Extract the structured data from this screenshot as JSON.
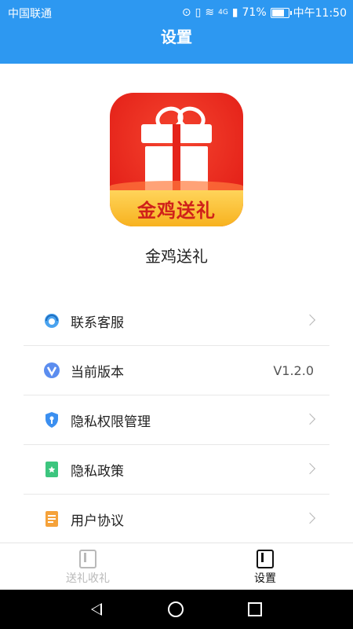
{
  "status_bar": {
    "carrier": "中国联通",
    "network": "4G",
    "battery": "71%",
    "battery_level": 0.71,
    "time": "中午11:50"
  },
  "header": {
    "title": "设置"
  },
  "app": {
    "logo_text": "金鸡送礼",
    "name": "金鸡送礼"
  },
  "menu": {
    "items": [
      {
        "label": "联系客服",
        "icon": "customer-service-icon"
      },
      {
        "label": "当前版本",
        "icon": "version-icon",
        "value": "V1.2.0"
      },
      {
        "label": "隐私权限管理",
        "icon": "privacy-permission-icon"
      },
      {
        "label": "隐私政策",
        "icon": "privacy-policy-icon"
      },
      {
        "label": "用户协议",
        "icon": "user-agreement-icon"
      }
    ]
  },
  "bottom_nav": {
    "tabs": [
      {
        "label": "送礼收礼",
        "active": false
      },
      {
        "label": "设置",
        "active": true
      }
    ]
  },
  "colors": {
    "primary": "#2d98f1",
    "logo_red": "#e5231a",
    "logo_gold": "#f7b21f"
  }
}
